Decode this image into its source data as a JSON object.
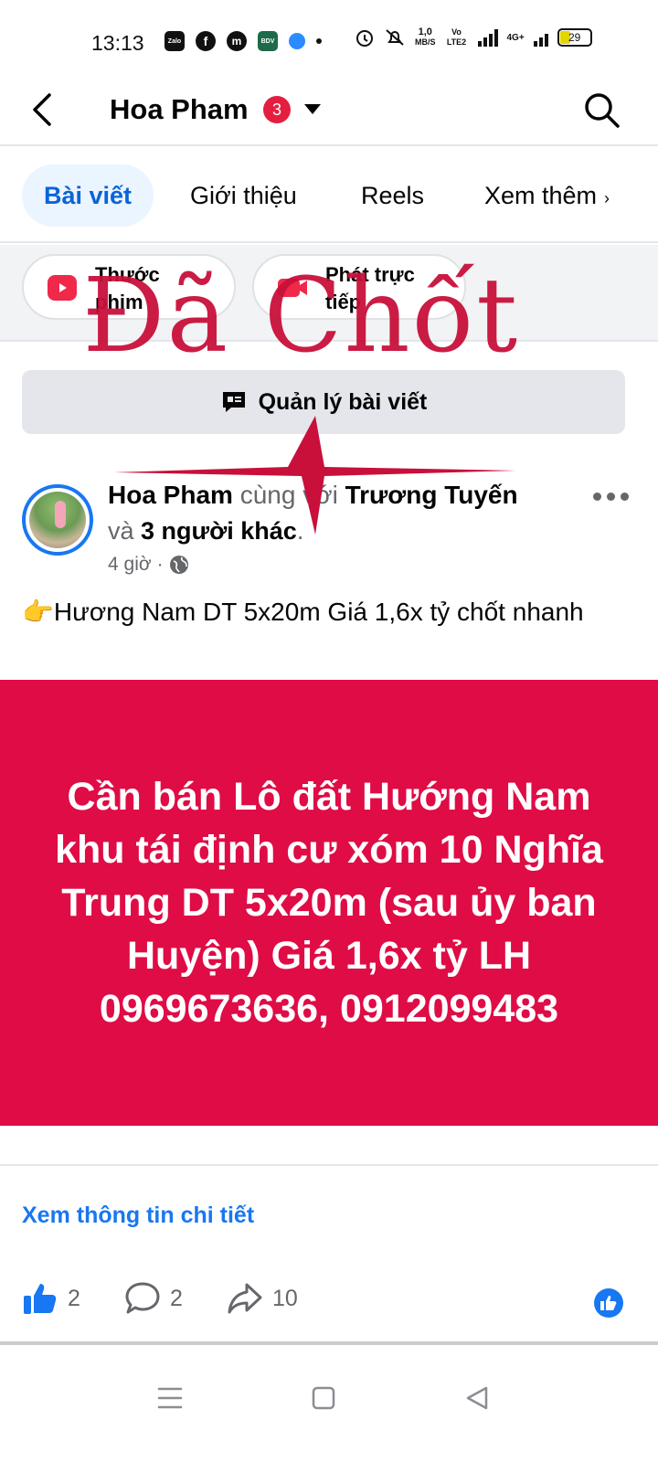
{
  "status_bar": {
    "time": "13:13",
    "apps": [
      "Zalo",
      "f",
      "m",
      "BDV",
      "•"
    ],
    "speed_value": "1,0",
    "speed_unit": "MB/S",
    "volte": "Vo LTE2",
    "network": "4G+",
    "battery": "29"
  },
  "header": {
    "title": "Hoa Pham",
    "badge_count": "3"
  },
  "tabs": [
    {
      "label": "Bài viết"
    },
    {
      "label": "Giới thiệu"
    },
    {
      "label": "Reels"
    },
    {
      "label": "Xem thêm"
    }
  ],
  "stories": [
    {
      "label": "Thước phim"
    },
    {
      "label": "Phát trực tiếp"
    }
  ],
  "manage": {
    "label": "Quản lý bài viết"
  },
  "post": {
    "author": "Hoa Pham",
    "with_text": " cùng với ",
    "tagged": "Trương Tuyến",
    "and_text": "và ",
    "others": "3 người khác",
    "period": ".",
    "time": "4 giờ",
    "sep": "·",
    "text": "👉Hương Nam DT 5x20m Giá 1,6x tỷ chốt nhanh",
    "image_text": "Cần bán Lô đất Hướng Nam khu  tái định cư xóm 10 Nghĩa Trung DT 5x20m (sau ủy ban Huyện) Giá 1,6x tỷ LH 0969673636, 0912099483",
    "detail_link": "Xem thông tin chi tiết",
    "likes": "2",
    "comments": "2",
    "shares": "10"
  },
  "watermark": {
    "text": "Đã Chốt"
  },
  "colors": {
    "accent": "#1877f2",
    "image_bg": "#df0c46",
    "watermark": "#c8103a",
    "badge": "#e41e3f"
  },
  "icons": [
    "back-arrow-icon",
    "search-icon",
    "reels-icon",
    "live-video-icon",
    "manage-posts-icon",
    "globe-icon",
    "like-icon",
    "comment-icon",
    "share-icon",
    "menu-icon",
    "home-square-icon",
    "back-triangle-icon"
  ]
}
